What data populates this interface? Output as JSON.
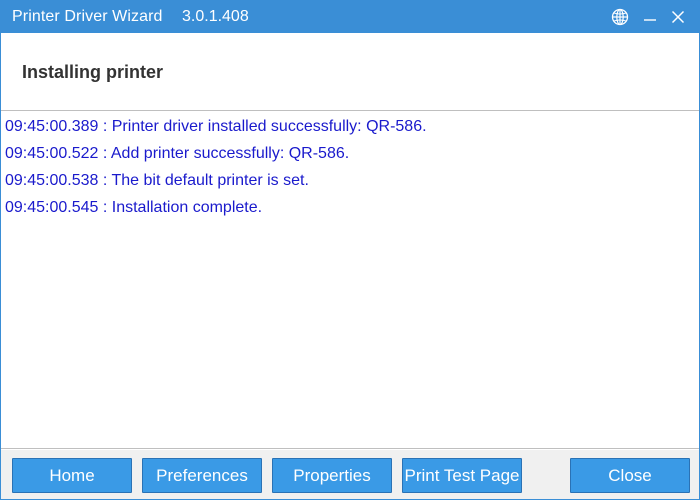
{
  "window": {
    "title": "Printer Driver Wizard",
    "version": "3.0.1.408",
    "accent_color": "#3a8ed6",
    "icons": {
      "language": "globe-icon",
      "minimize": "minimize-icon",
      "close": "close-icon"
    }
  },
  "header": {
    "heading": "Installing printer"
  },
  "log": {
    "text_color": "#1a1acc",
    "lines": [
      "09:45:00.389 : Printer driver installed successfully: QR-586.",
      "09:45:00.522 : Add printer successfully: QR-586.",
      "09:45:00.538 : The bit default printer is set.",
      "09:45:00.545 : Installation complete."
    ]
  },
  "footer": {
    "buttons": {
      "home": "Home",
      "preferences": "Preferences",
      "properties": "Properties",
      "print_test_page": "Print Test Page",
      "close": "Close"
    }
  }
}
